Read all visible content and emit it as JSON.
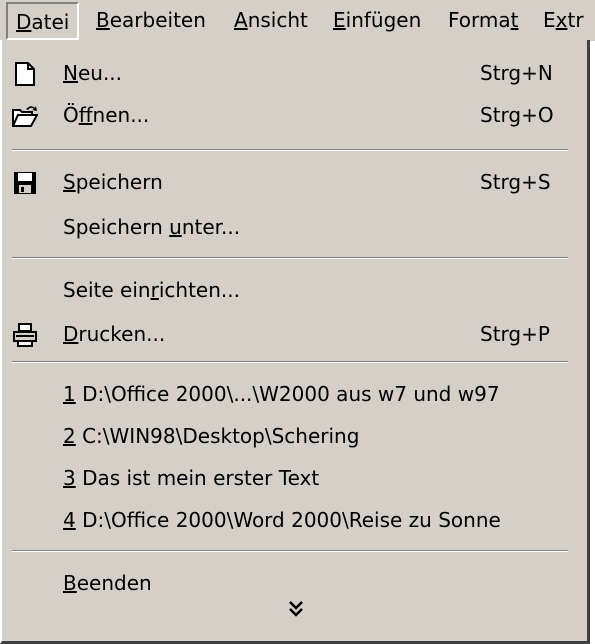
{
  "menubar": {
    "items": [
      {
        "text": "Datei",
        "key": "D"
      },
      {
        "text": "Bearbeiten",
        "key": "B"
      },
      {
        "text": "Ansicht",
        "key": "A"
      },
      {
        "text": "Einfügen",
        "key": "E"
      },
      {
        "text": "Format",
        "key": "t"
      },
      {
        "text": "Extras",
        "visible": "Extr",
        "key": "x"
      }
    ]
  },
  "menu": {
    "new": {
      "label": "Neu...",
      "shortcut": "Strg+N",
      "icon": "new-document-icon"
    },
    "open": {
      "label": "Öffnen...",
      "shortcut": "Strg+O",
      "icon": "open-folder-icon"
    },
    "save": {
      "label": "Speichern",
      "shortcut": "Strg+S",
      "icon": "floppy-disk-icon"
    },
    "save_as": {
      "label": "Speichern unter..."
    },
    "page_setup": {
      "label": "Seite einrichten..."
    },
    "print": {
      "label": "Drucken...",
      "shortcut": "Strg+P",
      "icon": "printer-icon"
    },
    "recent": [
      {
        "num": "1",
        "path": "D:\\Office 2000\\...\\W2000 aus w7 und w97"
      },
      {
        "num": "2",
        "path": "C:\\WIN98\\Desktop\\Schering"
      },
      {
        "num": "3",
        "path": "Das ist mein erster Text"
      },
      {
        "num": "4",
        "path": "D:\\Office 2000\\Word 2000\\Reise zu Sonne"
      }
    ],
    "exit": {
      "label": "Beenden"
    },
    "expand_icon": "double-chevron-down-icon"
  },
  "colors": {
    "menu_bg": "#d4d0c8",
    "shadow": "#808080",
    "dark_shadow": "#404040",
    "highlight": "#ffffff"
  }
}
